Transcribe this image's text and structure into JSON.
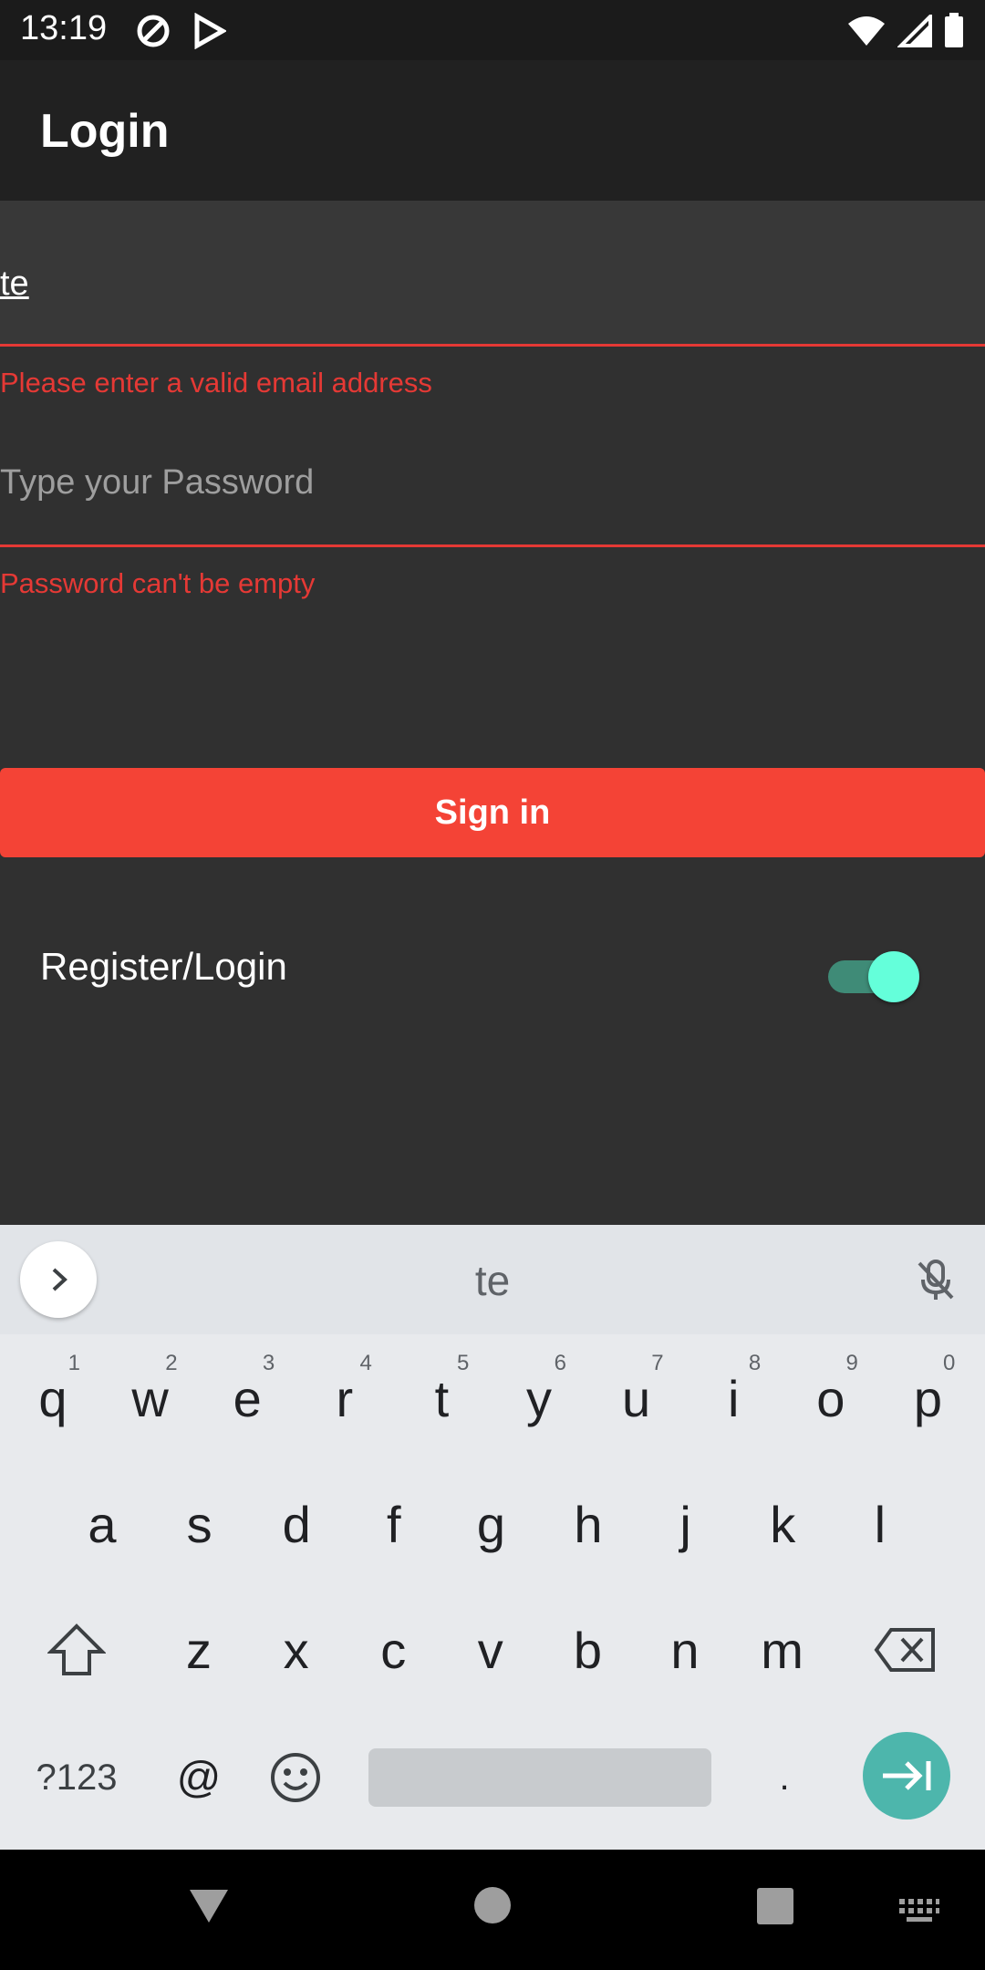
{
  "status": {
    "time": "13:19"
  },
  "app_bar": {
    "title": "Login"
  },
  "form": {
    "email_value": "te",
    "email_error": "Please enter a valid email address",
    "password_placeholder": "Type your Password",
    "password_error": "Password can't be empty",
    "signin_label": "Sign in",
    "register_label": "Register/Login",
    "register_toggle_on": true
  },
  "keyboard": {
    "suggestion": "te",
    "row1": [
      {
        "k": "q",
        "n": "1"
      },
      {
        "k": "w",
        "n": "2"
      },
      {
        "k": "e",
        "n": "3"
      },
      {
        "k": "r",
        "n": "4"
      },
      {
        "k": "t",
        "n": "5"
      },
      {
        "k": "y",
        "n": "6"
      },
      {
        "k": "u",
        "n": "7"
      },
      {
        "k": "i",
        "n": "8"
      },
      {
        "k": "o",
        "n": "9"
      },
      {
        "k": "p",
        "n": "0"
      }
    ],
    "row2": [
      "a",
      "s",
      "d",
      "f",
      "g",
      "h",
      "j",
      "k",
      "l"
    ],
    "row3": [
      "z",
      "x",
      "c",
      "v",
      "b",
      "n",
      "m"
    ],
    "symbols_label": "?123",
    "at_label": "@",
    "period_label": "."
  },
  "colors": {
    "accent_red": "#f44336",
    "error_red": "#e53935",
    "toggle_thumb": "#64ffda",
    "enter_key": "#4db6ac"
  }
}
